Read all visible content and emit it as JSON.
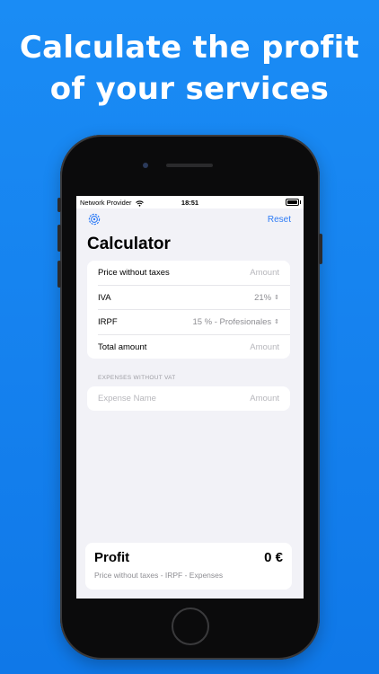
{
  "headline": {
    "line1": "Calculate the profit",
    "line2": "of your services"
  },
  "status_bar": {
    "carrier": "Network Provider",
    "time": "18:51"
  },
  "nav": {
    "reset_label": "Reset",
    "settings_icon": "gear-icon"
  },
  "page_title": "Calculator",
  "form": {
    "rows": [
      {
        "label": "Price without taxes",
        "value": "Amount"
      },
      {
        "label": "IVA",
        "value": "21%"
      },
      {
        "label": "IRPF",
        "value": "15 % - Profesionales"
      },
      {
        "label": "Total amount",
        "value": "Amount"
      }
    ]
  },
  "expenses": {
    "section_title": "EXPENSES WITHOUT VAT",
    "name_placeholder": "Expense Name",
    "amount_placeholder": "Amount"
  },
  "profit": {
    "label": "Profit",
    "value": "0 €",
    "formula": "Price without taxes - IRPF - Expenses"
  },
  "colors": {
    "background": "#1a8cf5",
    "accent": "#2f7cf6"
  }
}
